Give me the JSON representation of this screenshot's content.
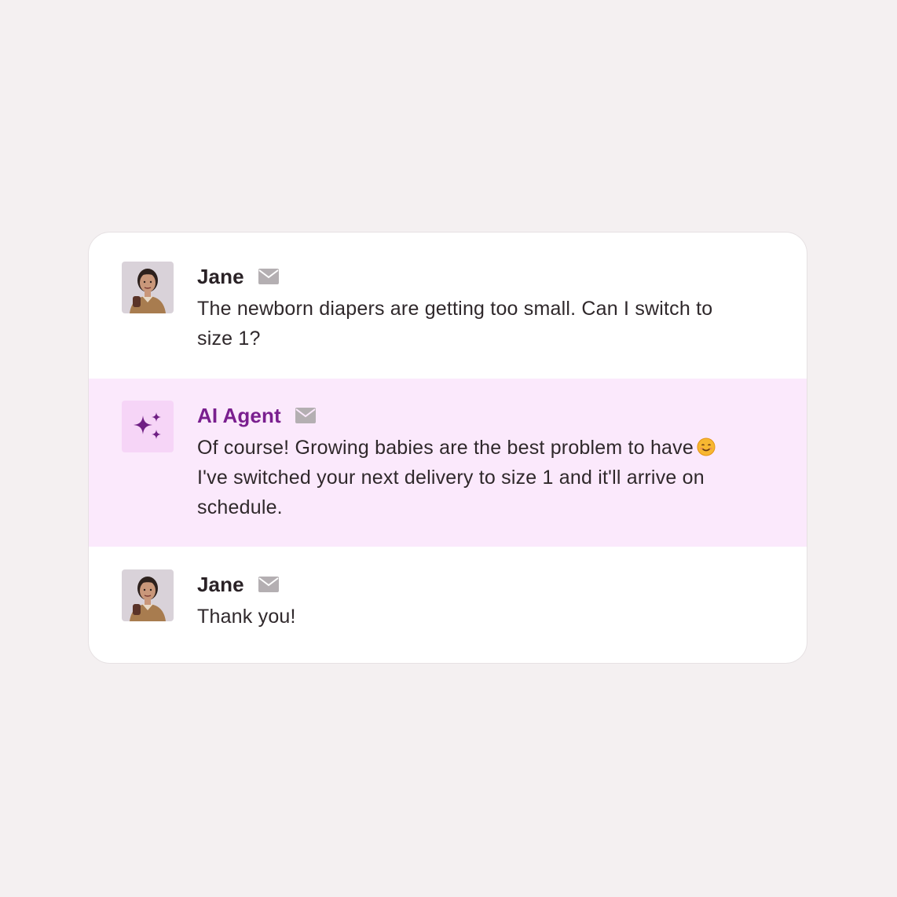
{
  "messages": [
    {
      "sender": "Jane",
      "channel_icon": "mail-icon",
      "text": "The newborn diapers are getting too small. Can I switch to size 1?"
    },
    {
      "sender": "AI Agent",
      "channel_icon": "mail-icon",
      "avatar_icon": "sparkles-icon",
      "text_before_emoji": "Of course! Growing babies are the best problem to have",
      "emoji": "smiling-face-emoji",
      "text_after_emoji": "I've switched your next delivery to size 1 and it'll arrive on schedule."
    },
    {
      "sender": "Jane",
      "channel_icon": "mail-icon",
      "text": "Thank you!"
    }
  ],
  "colors": {
    "background": "#f4f0f1",
    "card": "#ffffff",
    "agent_row": "#fbe9fc",
    "agent_name": "#7a1f8f",
    "agent_avatar_bg": "#f6d5f7",
    "mail_icon": "#b4afb2"
  }
}
